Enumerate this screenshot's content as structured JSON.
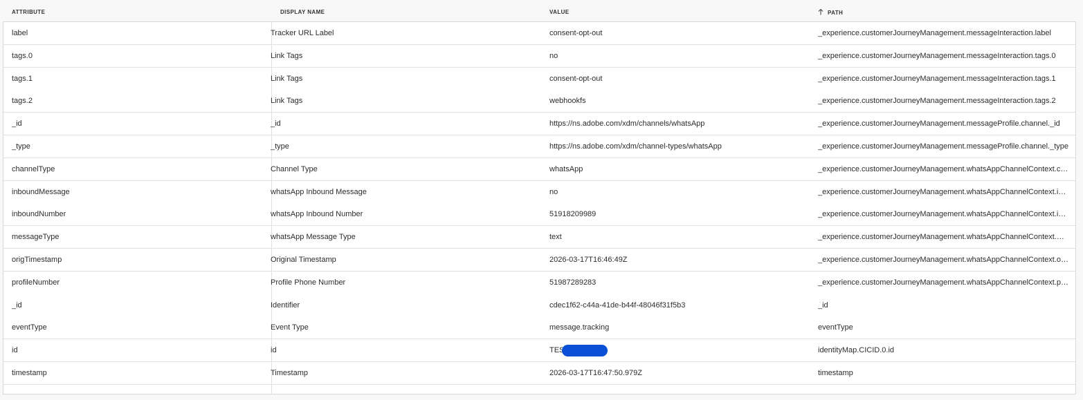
{
  "columns": {
    "attribute": "ATTRIBUTE",
    "display_name": "DISPLAY NAME",
    "value": "VALUE",
    "path": "PATH"
  },
  "rows": [
    {
      "attribute": "label",
      "display_name": "Tracker URL Label",
      "value": "consent-opt-out",
      "path": "_experience.customerJourneyManagement.messageInteraction.label"
    },
    {
      "attribute": "tags.0",
      "display_name": "Link Tags",
      "value": "no",
      "path": "_experience.customerJourneyManagement.messageInteraction.tags.0"
    },
    {
      "attribute": "tags.1",
      "display_name": "Link Tags",
      "value": "consent-opt-out",
      "path": "_experience.customerJourneyManagement.messageInteraction.tags.1"
    },
    {
      "attribute": "tags.2",
      "display_name": "Link Tags",
      "value": "webhookfs",
      "path": "_experience.customerJourneyManagement.messageInteraction.tags.2"
    },
    {
      "attribute": "_id",
      "display_name": "_id",
      "value": "https://ns.adobe.com/xdm/channels/whatsApp",
      "path": "_experience.customerJourneyManagement.messageProfile.channel._id"
    },
    {
      "attribute": "_type",
      "display_name": "_type",
      "value": "https://ns.adobe.com/xdm/channel-types/whatsApp",
      "path": "_experience.customerJourneyManagement.messageProfile.channel._type"
    },
    {
      "attribute": "channelType",
      "display_name": "Channel Type",
      "value": "whatsApp",
      "path": "_experience.customerJourneyManagement.whatsAppChannelContext.channelType"
    },
    {
      "attribute": "inboundMessage",
      "display_name": "whatsApp Inbound Message",
      "value": "no",
      "path": "_experience.customerJourneyManagement.whatsAppChannelContext.inboundMessage"
    },
    {
      "attribute": "inboundNumber",
      "display_name": "whatsApp Inbound Number",
      "value": "51918209989",
      "path": "_experience.customerJourneyManagement.whatsAppChannelContext.inboundNumber"
    },
    {
      "attribute": "messageType",
      "display_name": "whatsApp Message Type",
      "value": "text",
      "path": "_experience.customerJourneyManagement.whatsAppChannelContext.messageType"
    },
    {
      "attribute": "origTimestamp",
      "display_name": "Original Timestamp",
      "value": "2026-03-17T16:46:49Z",
      "path": "_experience.customerJourneyManagement.whatsAppChannelContext.origTimestamp"
    },
    {
      "attribute": "profileNumber",
      "display_name": "Profile Phone Number",
      "value": "51987289283",
      "path": "_experience.customerJourneyManagement.whatsAppChannelContext.profileNumber"
    },
    {
      "attribute": "_id",
      "display_name": "Identifier",
      "value": "cdec1f62-c44a-41de-b44f-48046f31f5b3",
      "path": "_id"
    },
    {
      "attribute": "eventType",
      "display_name": "Event Type",
      "value": "message.tracking",
      "path": "eventType"
    },
    {
      "attribute": "id",
      "display_name": "id",
      "value": "TES",
      "path": "identityMap.CICID.0.id"
    },
    {
      "attribute": "timestamp",
      "display_name": "Timestamp",
      "value": "2026-03-17T16:47:50.979Z",
      "path": "timestamp"
    }
  ],
  "colors": {
    "redaction": "#0a4fd6",
    "border": "#e1e1e1",
    "background": "#f8f8f8"
  },
  "icons": {
    "path_sort": "arrow-up-icon"
  }
}
